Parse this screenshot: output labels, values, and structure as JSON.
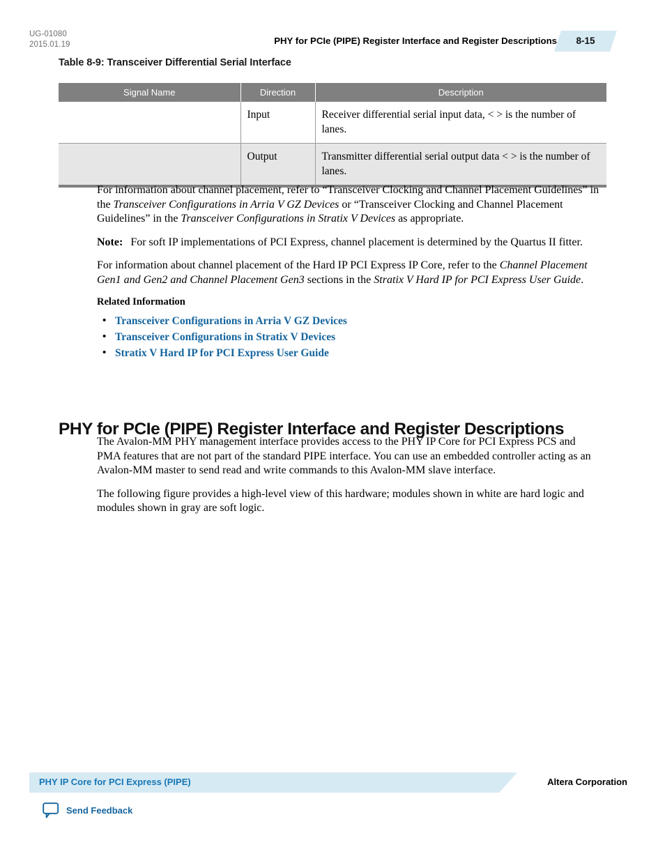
{
  "header": {
    "doc_id": "UG-01080",
    "doc_date": "2015.01.19",
    "running_title": "PHY for PCIe (PIPE) Register Interface and Register Descriptions",
    "page_number": "8-15"
  },
  "table": {
    "caption": "Table 8-9: Transceiver Differential Serial Interface",
    "columns": [
      "Signal Name",
      "Direction",
      "Description"
    ],
    "rows": [
      {
        "signal_name": "",
        "direction": "Input",
        "description": "Receiver differential serial input data, <  > is the number of lanes."
      },
      {
        "signal_name": "",
        "direction": "Output",
        "description": "Transmitter differential serial output data <  > is the number of lanes."
      }
    ]
  },
  "body": {
    "para1_part1": "For information about channel placement, refer to “Transceiver Clocking and Channel Placement Guidelines” in the ",
    "para1_italic1": "Transceiver Configurations in Arria V GZ Devices",
    "para1_part2": " or “Transceiver Clocking and Channel Placement Guidelines” in the ",
    "para1_italic2": "Transceiver Configurations in Stratix V Devices",
    "para1_part3": " as appropriate.",
    "note_label": "Note:",
    "note_text": "For soft IP implementations of PCI Express, channel placement is determined by the Quartus II fitter.",
    "para2_part1": "For information about channel placement of the Hard IP PCI Express IP Core, refer to the ",
    "para2_italic1": "Channel Placement Gen1 and Gen2 and Channel Placement Gen3",
    "para2_part2": " sections in the ",
    "para2_italic2": "Stratix V Hard IP for PCI Express User Guide",
    "para2_part3": ".",
    "related_heading": "Related Information",
    "related_links": [
      "Transceiver Configurations in Arria V GZ Devices",
      "Transceiver Configurations in Stratix V Devices",
      "Stratix V Hard IP for PCI Express User Guide"
    ]
  },
  "section": {
    "heading": "PHY for PCIe (PIPE) Register Interface and Register Descriptions",
    "para1": "The Avalon-MM PHY management interface provides access to the PHY IP Core for PCI Express PCS and PMA features that are not part of the standard PIPE interface. You can use an embedded controller acting as an Avalon-MM master to send read and write commands to this Avalon-MM slave interface.",
    "para2": "The following figure provides a high-level view of this hardware; modules shown in white are hard logic and modules shown in gray are soft logic."
  },
  "footer": {
    "band_label": "PHY IP Core for PCI Express (PIPE)",
    "corporation": "Altera Corporation",
    "feedback_label": "Send Feedback"
  },
  "colors": {
    "accent_blue": "#15659e",
    "band_blue": "#d6eaf4",
    "table_header_gray": "#808080",
    "row_alt_gray": "#e6e6e6"
  }
}
